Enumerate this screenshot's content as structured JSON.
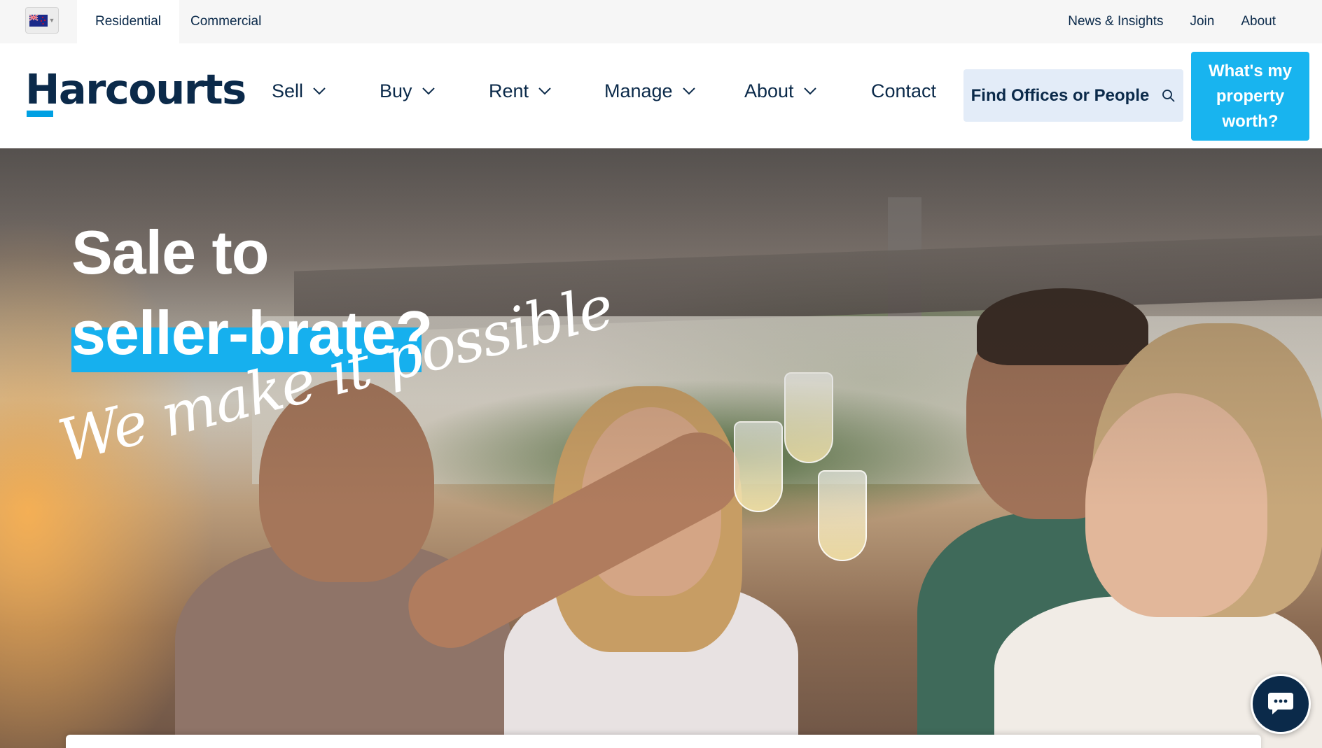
{
  "utility_bar": {
    "region_selector": {
      "icon": "nz-flag-icon"
    },
    "segments": [
      {
        "label": "Residential",
        "active": true
      },
      {
        "label": "Commercial",
        "active": false
      }
    ],
    "links": [
      "News & Insights",
      "Join",
      "About"
    ]
  },
  "brand": {
    "name": "Harcourts",
    "accent_color": "#00a0e3",
    "navy": "#0b2a4a"
  },
  "nav": {
    "items": [
      {
        "label": "Sell",
        "has_dropdown": true
      },
      {
        "label": "Buy",
        "has_dropdown": true
      },
      {
        "label": "Rent",
        "has_dropdown": true
      },
      {
        "label": "Manage",
        "has_dropdown": true
      },
      {
        "label": "About",
        "has_dropdown": true
      },
      {
        "label": "Contact",
        "has_dropdown": false
      }
    ],
    "find_button": {
      "label": "Find Offices or People",
      "icon": "search-icon"
    },
    "cta_button": {
      "label": "What's my property worth?",
      "color": "#18b4ef"
    }
  },
  "hero": {
    "headline_line1": "Sale to",
    "headline_line2": "seller-brate?",
    "tagline": "We make it possible",
    "highlight_color": "#16b0ee"
  },
  "chat": {
    "icon": "chat-bubble-icon"
  }
}
